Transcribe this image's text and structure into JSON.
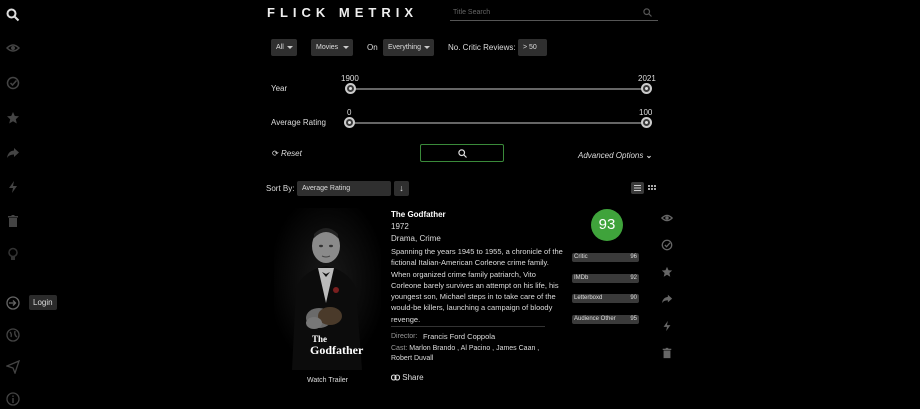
{
  "app": {
    "logo": "FLICK METRIX"
  },
  "sidebar": {
    "login_label": "Login"
  },
  "search": {
    "placeholder": "Title Search"
  },
  "filters": {
    "availability": "All",
    "type": "Movies",
    "on_label": "On",
    "service": "Everything",
    "critic_reviews_label": "No. Critic Reviews:",
    "critic_reviews_value": "> 50",
    "year_label": "Year",
    "year_min": "1900",
    "year_max": "2021",
    "rating_label": "Average Rating",
    "rating_min": "0",
    "rating_max": "100",
    "reset_label": "Reset",
    "advanced_label": "Advanced Options"
  },
  "sort": {
    "label": "Sort By:",
    "value": "Average Rating",
    "direction": "↓"
  },
  "movie": {
    "title": "The Godfather",
    "year": "1972",
    "genres": "Drama, Crime",
    "plot": "Spanning the years 1945 to 1955, a chronicle of the fictional Italian-American Corleone crime family. When organized crime family patriarch, Vito Corleone barely survives an attempt on his life, his youngest son, Michael steps in to take care of the would-be killers, launching a campaign of bloody revenge.",
    "director_label": "Director:",
    "director": "Francis Ford Coppola",
    "cast_label": "Cast:",
    "cast": "Marlon Brando , Al Pacino , James Caan , Robert Duvall",
    "share_label": "Share",
    "trailer_label": "Watch Trailer",
    "poster_title_1": "The",
    "poster_title_2": "Godfather",
    "score": "93",
    "ratings": [
      {
        "name": "Critic",
        "value": "96"
      },
      {
        "name": "IMDb",
        "value": "92"
      },
      {
        "name": "Letterboxd",
        "value": "90"
      },
      {
        "name": "Audience Other",
        "value": "95"
      }
    ]
  },
  "colors": {
    "accent_green": "#3fa33b",
    "background": "#000000"
  }
}
